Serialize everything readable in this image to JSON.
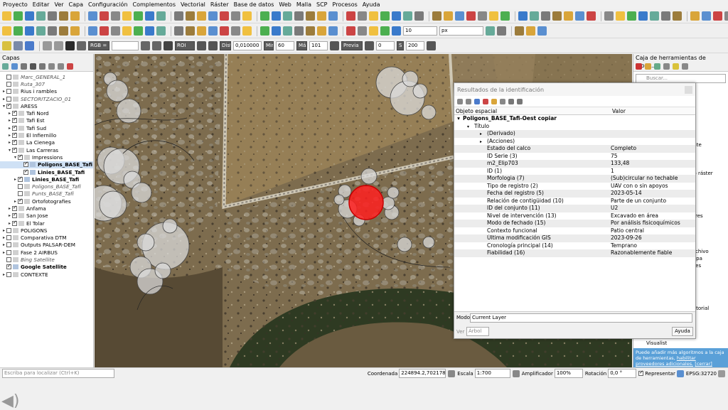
{
  "menu": [
    "Proyecto",
    "Editar",
    "Ver",
    "Capa",
    "Configuración",
    "Complementos",
    "Vectorial",
    "Ráster",
    "Base de datos",
    "Web",
    "Malla",
    "SCP",
    "Procesos",
    "Ayuda"
  ],
  "toolbar2": {
    "tolerance": "10",
    "unit": "px"
  },
  "toolbar3": {
    "rgb_label": "RGB =",
    "roi_label": "ROI",
    "dist_label": "Dist",
    "dist_value": "0,010000",
    "min_label": "Min",
    "min_value": "60",
    "max_label": "Máx",
    "max_value": "101",
    "preview_label": "Previa",
    "val1": "0",
    "s_label": "S",
    "s_value": "200"
  },
  "layers_panel": {
    "title": "Capas",
    "layers": [
      {
        "name": "Marc_GENERAL_1",
        "indent": 0,
        "style": "it",
        "checked": false,
        "expander": ""
      },
      {
        "name": "Ruta_307",
        "indent": 0,
        "style": "it",
        "checked": false,
        "expander": ""
      },
      {
        "name": "Rius i rambles",
        "indent": 0,
        "style": "",
        "checked": false,
        "expander": "▸"
      },
      {
        "name": "SECTORITZACIO_01",
        "indent": 0,
        "style": "it",
        "checked": false,
        "expander": "▸"
      },
      {
        "name": "ARESS",
        "indent": 0,
        "style": "",
        "checked": true,
        "expander": "▾"
      },
      {
        "name": "Tafi Nord",
        "indent": 1,
        "style": "",
        "checked": true,
        "expander": "▸"
      },
      {
        "name": "Tafi Est",
        "indent": 1,
        "style": "",
        "checked": true,
        "expander": "▸"
      },
      {
        "name": "Tafi Sud",
        "indent": 1,
        "style": "",
        "checked": true,
        "expander": "▸"
      },
      {
        "name": "El Infiernillo",
        "indent": 1,
        "style": "",
        "checked": true,
        "expander": "▸"
      },
      {
        "name": "La Cienega",
        "indent": 1,
        "style": "",
        "checked": true,
        "expander": "▸"
      },
      {
        "name": "Las Carreras",
        "indent": 1,
        "style": "",
        "checked": true,
        "expander": "▾"
      },
      {
        "name": "Impressions",
        "indent": 2,
        "style": "",
        "checked": true,
        "expander": "▾"
      },
      {
        "name": "Poligons_BASE_Tafi",
        "indent": 3,
        "style": "bd",
        "checked": true,
        "expander": "",
        "selected": true
      },
      {
        "name": "Linies_BASE_Tafi",
        "indent": 3,
        "style": "bd",
        "checked": true,
        "expander": ""
      },
      {
        "name": "Linies_BASE_Tafi",
        "indent": 2,
        "style": "bd",
        "checked": true,
        "expander": "▸"
      },
      {
        "name": "Poligons_BASE_Tafi",
        "indent": 2,
        "style": "it",
        "checked": false,
        "expander": ""
      },
      {
        "name": "Punts_BASE_Tafi",
        "indent": 2,
        "style": "it",
        "checked": false,
        "expander": ""
      },
      {
        "name": "Ortofotografies",
        "indent": 2,
        "style": "",
        "checked": true,
        "expander": "▸"
      },
      {
        "name": "Anfama",
        "indent": 1,
        "style": "",
        "checked": true,
        "expander": "▸"
      },
      {
        "name": "San Jose",
        "indent": 1,
        "style": "",
        "checked": true,
        "expander": "▸"
      },
      {
        "name": "El Tolar",
        "indent": 1,
        "style": "",
        "checked": true,
        "expander": "▸"
      },
      {
        "name": "POLIGONS",
        "indent": 0,
        "style": "",
        "checked": false,
        "expander": "▸"
      },
      {
        "name": "Comparativa DTM",
        "indent": 0,
        "style": "",
        "checked": false,
        "expander": "▸"
      },
      {
        "name": "Outputs PALSAR-DEM",
        "indent": 0,
        "style": "",
        "checked": false,
        "expander": "▸"
      },
      {
        "name": "Fase 2 AIRBUS",
        "indent": 0,
        "style": "",
        "checked": false,
        "expander": "▸"
      },
      {
        "name": "Bing Satellite",
        "indent": 0,
        "style": "it",
        "checked": false,
        "expander": ""
      },
      {
        "name": "Google Satellite",
        "indent": 0,
        "style": "bd",
        "checked": true,
        "expander": ""
      },
      {
        "name": "CONTEXTE",
        "indent": 0,
        "style": "",
        "checked": false,
        "expander": "▸"
      }
    ]
  },
  "toolbox": {
    "title": "Caja de herramientas de Proce...",
    "search_placeholder": "Buscar...",
    "fragments": [
      "",
      "",
      "",
      "",
      "",
      "",
      "",
      "",
      "ente",
      "",
      "",
      "",
      "no ráster",
      "",
      "",
      "",
      "",
      "",
      "tores",
      "",
      "",
      "",
      "",
      "archivo",
      "capa",
      "ntes",
      "",
      "",
      "",
      "ial",
      "",
      "ectorial",
      "",
      "",
      "",
      "",
      "",
      "",
      "",
      "",
      "nalysis"
    ],
    "tree_items": [
      "Visibility analysis",
      "Visualist"
    ],
    "info_text": "Puede añadir más algoritmos a la caja de herramientas,",
    "info_link1": "habilitar proveedores adicionales.",
    "info_link2": "[cerrar]"
  },
  "identify": {
    "title": "Resultados de la identificación",
    "col_feature": "Objeto espacial",
    "col_value": "Valor",
    "feature": "Poligons_BASE_Tafi-Oest copiar",
    "rows": [
      {
        "k": "Título",
        "v": "",
        "indent": 1,
        "arrow": "▾"
      },
      {
        "k": "(Derivado)",
        "v": "",
        "indent": 2,
        "arrow": "▸"
      },
      {
        "k": "(Acciones)",
        "v": "",
        "indent": 2,
        "arrow": "▸"
      },
      {
        "k": "Estado del calco",
        "v": "Completo",
        "indent": 2,
        "arrow": ""
      },
      {
        "k": "ID Serie (3)",
        "v": "75",
        "indent": 2,
        "arrow": ""
      },
      {
        "k": "m2_Elip703",
        "v": "133,48",
        "indent": 2,
        "arrow": ""
      },
      {
        "k": "ID (1)",
        "v": "1",
        "indent": 2,
        "arrow": ""
      },
      {
        "k": "Morfologia (7)",
        "v": "(Sub)circular no techable",
        "indent": 2,
        "arrow": ""
      },
      {
        "k": "Tipo de registro (2)",
        "v": "UAV con o sin apoyos",
        "indent": 2,
        "arrow": ""
      },
      {
        "k": "Fecha del registro (5)",
        "v": "2023-05-14",
        "indent": 2,
        "arrow": ""
      },
      {
        "k": "Relación de contigüidad (10)",
        "v": "Parte de un conjunto",
        "indent": 2,
        "arrow": ""
      },
      {
        "k": "ID del conjunto (11)",
        "v": "U2",
        "indent": 2,
        "arrow": ""
      },
      {
        "k": "Nivel de intervención (13)",
        "v": "Excavado en área",
        "indent": 2,
        "arrow": ""
      },
      {
        "k": "Modo de fechado (15)",
        "v": "Por análisis fisicoquímicos",
        "indent": 2,
        "arrow": ""
      },
      {
        "k": "Contexto funcional",
        "v": "Patio central",
        "indent": 2,
        "arrow": ""
      },
      {
        "k": "Última modificación GIS",
        "v": "2023-09-26",
        "indent": 2,
        "arrow": ""
      },
      {
        "k": "Cronología principal (14)",
        "v": "Temprano",
        "indent": 2,
        "arrow": ""
      },
      {
        "k": "Fiabilidad (16)",
        "v": "Razonablemente fiable",
        "indent": 2,
        "arrow": ""
      }
    ],
    "mode_label": "Modo",
    "mode_value": "Current Layer",
    "view_label": "Ver",
    "view_value": "Árbol",
    "help_label": "Ayuda"
  },
  "status": {
    "locator_placeholder": "Escriba para localizar (Ctrl+K)",
    "coord_label": "Coordenada",
    "coord_value": "224894.2,7021789.7",
    "scale_label": "Escala",
    "scale_value": "1:700",
    "magnifier_label": "Amplificador",
    "magnifier_value": "100%",
    "rotation_label": "Rotación",
    "rotation_value": "0,0 °",
    "render_label": "Representar",
    "crs": "EPSG:32720"
  }
}
